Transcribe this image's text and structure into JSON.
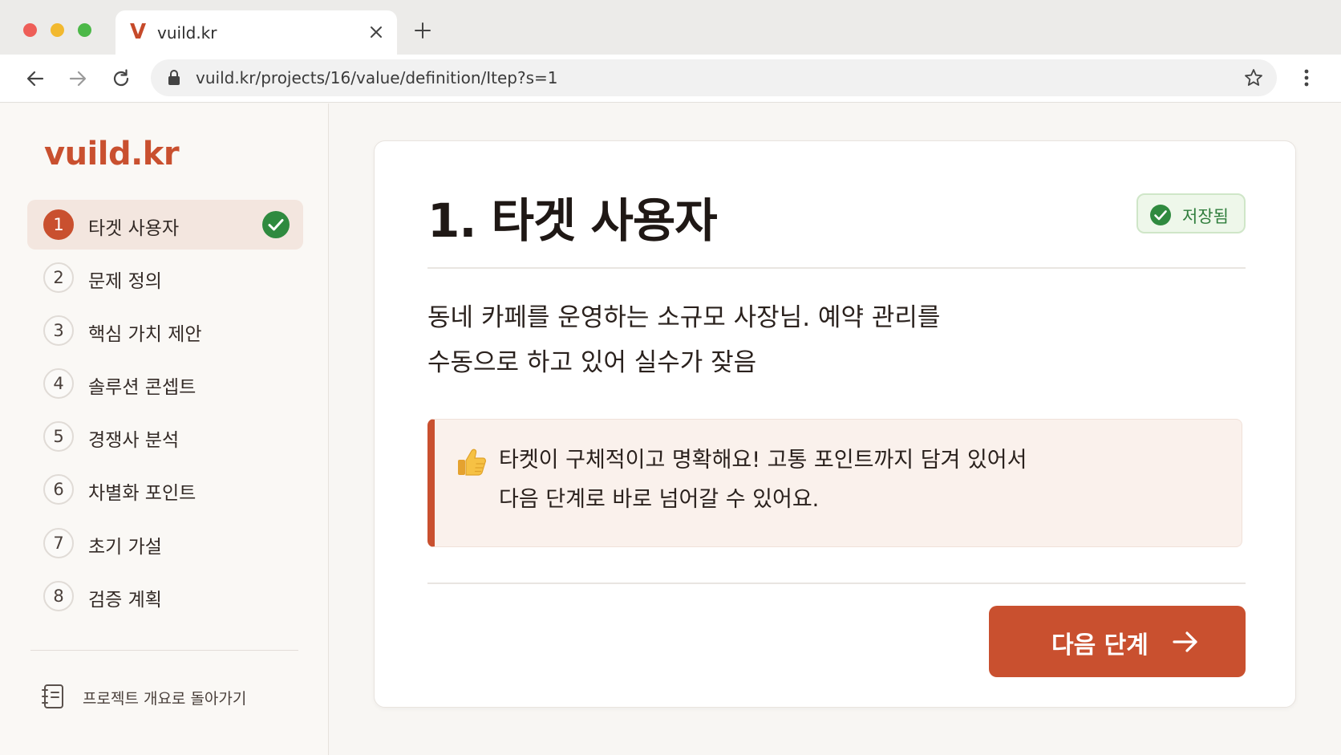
{
  "browser": {
    "tab_title": "vuild.kr",
    "tab_favicon": "V",
    "url": "vuild.kr/projects/16/value/definition/Itep?s=1",
    "icons": [
      "close-icon",
      "plus-icon",
      "back-arrow-icon",
      "forward-arrow-icon",
      "reload-icon",
      "lock-icon",
      "star-icon",
      "more-vert-icon"
    ]
  },
  "sidebar": {
    "brand": "vuild.kr",
    "steps": [
      {
        "num": "1",
        "label": "타겟 사용자",
        "active": true,
        "completed": true
      },
      {
        "num": "2",
        "label": "문제 정의"
      },
      {
        "num": "3",
        "label": "핵심 가치 제안"
      },
      {
        "num": "4",
        "label": "솔루션 콘셉트"
      },
      {
        "num": "5",
        "label": "경쟁사 분석"
      },
      {
        "num": "6",
        "label": "차별화 포인트"
      },
      {
        "num": "7",
        "label": "초기 가설"
      },
      {
        "num": "8",
        "label": "검증 계획"
      }
    ],
    "back_link": "프로젝트 개요로 돌아가기"
  },
  "main": {
    "title": "1. 타겟 사용자",
    "saved_badge": "저장됨",
    "description_lines": [
      "동네 카페를 운영하는 소규모 사장님. 예약 관리를",
      "수동으로 하고 있어 실수가 잦음"
    ],
    "feedback_lines": [
      "타켓이 구체적이고 명확해요! 고통 포인트까지 담겨 있어서",
      "다음 단계로 바로 넘어갈 수 있어요."
    ],
    "next_button": "다음 단계"
  },
  "colors": {
    "accent": "#c9502f",
    "success": "#2f8a3f",
    "saved_bg": "#eef7ea",
    "feedback_bg": "#faf1ec"
  }
}
